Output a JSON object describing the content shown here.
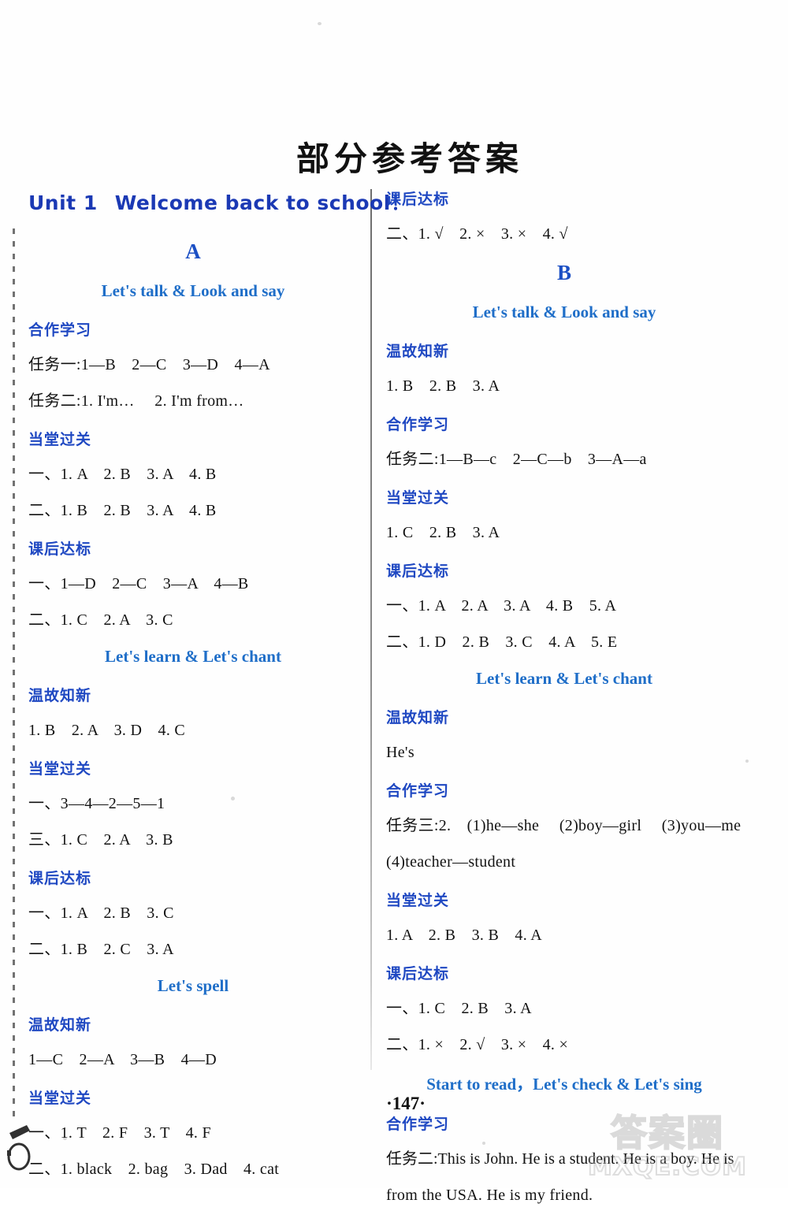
{
  "page": {
    "title": "部分参考答案",
    "page_number": "·147·"
  },
  "watermark": {
    "cn": "答案圈",
    "en": "MXQE.COM"
  },
  "left_column": {
    "unit": {
      "number": "Unit 1",
      "name": "Welcome back to school",
      "punct": "！"
    },
    "part": "A",
    "blocks": [
      {
        "kind": "lesson",
        "text": "Let's talk & Look and say"
      },
      {
        "kind": "head",
        "text": "合作学习"
      },
      {
        "kind": "answer",
        "text": "任务一:1—B　2—C　3—D　4—A"
      },
      {
        "kind": "answer",
        "text": "任务二:1. I'm…　 2. I'm from…"
      },
      {
        "kind": "head",
        "text": "当堂过关"
      },
      {
        "kind": "answer",
        "text": "一、1. A　2. B　3. A　4. B"
      },
      {
        "kind": "answer",
        "text": "二、1. B　2. B　3. A　4. B"
      },
      {
        "kind": "head",
        "text": "课后达标"
      },
      {
        "kind": "answer",
        "text": "一、1—D　2—C　3—A　4—B"
      },
      {
        "kind": "answer",
        "text": "二、1. C　2. A　3. C"
      },
      {
        "kind": "lesson",
        "text": "Let's learn & Let's chant"
      },
      {
        "kind": "head",
        "text": "温故知新"
      },
      {
        "kind": "answer",
        "text": "1. B　2. A　3. D　4. C"
      },
      {
        "kind": "head",
        "text": "当堂过关"
      },
      {
        "kind": "answer",
        "text": "一、3—4—2—5—1"
      },
      {
        "kind": "answer",
        "text": "三、1. C　2. A　3. B"
      },
      {
        "kind": "head",
        "text": "课后达标"
      },
      {
        "kind": "answer",
        "text": "一、1. A　2. B　3. C"
      },
      {
        "kind": "answer",
        "text": "二、1. B　2. C　3. A"
      },
      {
        "kind": "lesson",
        "text": "Let's spell"
      },
      {
        "kind": "head",
        "text": "温故知新"
      },
      {
        "kind": "answer",
        "text": "1—C　2—A　3—B　4—D"
      },
      {
        "kind": "head",
        "text": "当堂过关"
      },
      {
        "kind": "answer",
        "text": "一、1. T　2. F　3. T　4. F"
      },
      {
        "kind": "answer",
        "text": "二、1. black　2. bag　3. Dad　4. cat"
      }
    ]
  },
  "right_column": {
    "part": "B",
    "blocks": [
      {
        "kind": "head",
        "text": "课后达标"
      },
      {
        "kind": "answer",
        "text": "二、1. √　2. ×　3. ×　4. √"
      },
      {
        "kind": "part",
        "text": "B"
      },
      {
        "kind": "lesson",
        "text": "Let's talk & Look and say"
      },
      {
        "kind": "head",
        "text": "温故知新"
      },
      {
        "kind": "answer",
        "text": "1. B　2. B　3. A"
      },
      {
        "kind": "head",
        "text": "合作学习"
      },
      {
        "kind": "answer",
        "text": "任务二:1—B—c　2—C—b　3—A—a"
      },
      {
        "kind": "head",
        "text": "当堂过关"
      },
      {
        "kind": "answer",
        "text": "1. C　2. B　3. A"
      },
      {
        "kind": "head",
        "text": "课后达标"
      },
      {
        "kind": "answer",
        "text": "一、1. A　2. A　3. A　4. B　5. A"
      },
      {
        "kind": "answer",
        "text": "二、1. D　2. B　3. C　4. A　5. E"
      },
      {
        "kind": "lesson",
        "text": "Let's learn & Let's chant"
      },
      {
        "kind": "head",
        "text": "温故知新"
      },
      {
        "kind": "answer",
        "text": "He's"
      },
      {
        "kind": "head",
        "text": "合作学习"
      },
      {
        "kind": "answer",
        "text": "任务三:2.　(1)he—she　 (2)boy—girl　 (3)you—me"
      },
      {
        "kind": "answer",
        "text": "(4)teacher—student"
      },
      {
        "kind": "head",
        "text": "当堂过关"
      },
      {
        "kind": "answer",
        "text": "1. A　2. B　3. B　4. A"
      },
      {
        "kind": "head",
        "text": "课后达标"
      },
      {
        "kind": "answer",
        "text": "一、1. C　2. B　3. A"
      },
      {
        "kind": "answer",
        "text": "二、1. ×　2. √　3. ×　4. ×"
      },
      {
        "kind": "lesson",
        "text": "Start to read，Let's check & Let's sing"
      },
      {
        "kind": "head",
        "text": "合作学习"
      },
      {
        "kind": "answer",
        "text": "任务二:This is John. He is a student. He is a boy. He is"
      },
      {
        "kind": "answer",
        "text": "from the USA. He is my friend."
      }
    ]
  }
}
